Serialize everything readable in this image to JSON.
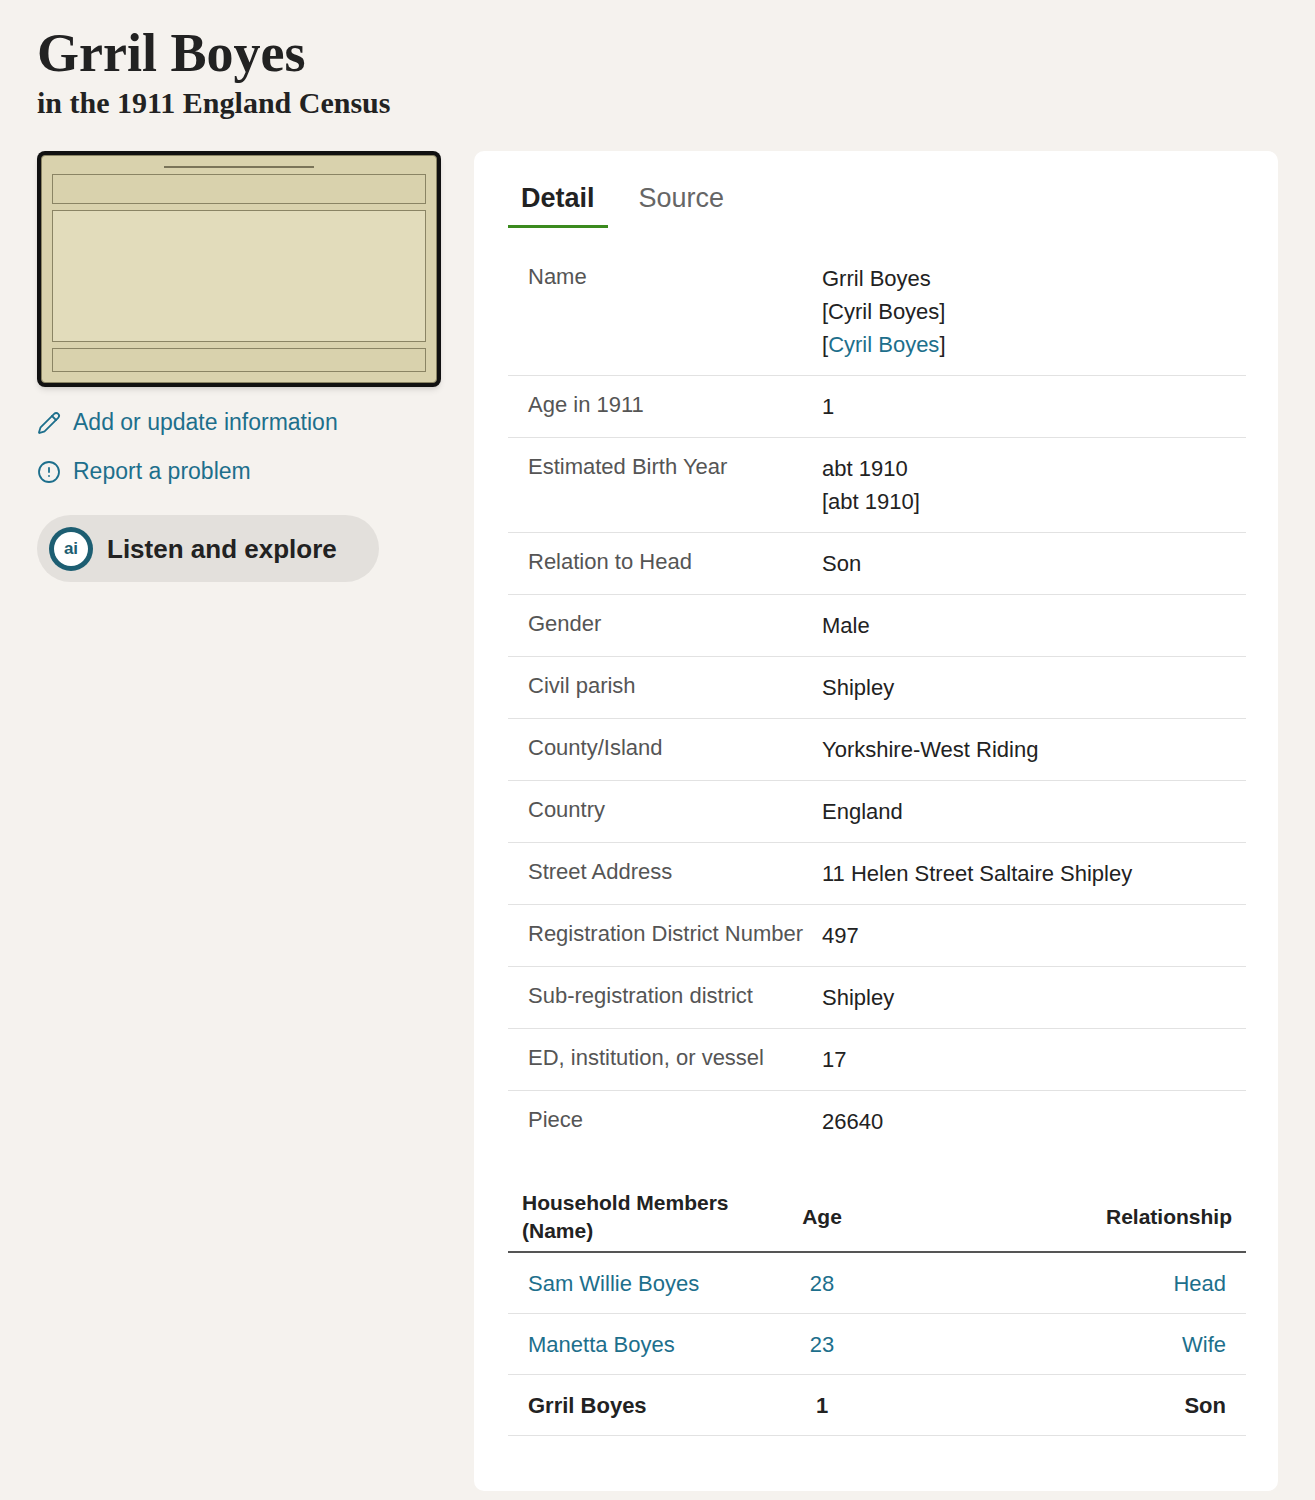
{
  "page": {
    "title": "Grril Boyes",
    "subtitle": "in the 1911 England Census"
  },
  "sidebar": {
    "links": [
      {
        "label": "Add or update information",
        "kind": "edit"
      },
      {
        "label": "Report a problem",
        "kind": "report"
      }
    ],
    "button": {
      "badge": "ai",
      "label": "Listen and explore"
    }
  },
  "tabs": [
    {
      "label": "Detail",
      "selected": true
    },
    {
      "label": "Source",
      "selected": false
    }
  ],
  "details": [
    {
      "label": "Name",
      "values": [
        {
          "prefix": "",
          "text": "Grril Boyes",
          "suffix": "",
          "link": false
        },
        {
          "prefix": "",
          "text": "[Cyril Boyes]",
          "suffix": "",
          "link": false
        },
        {
          "prefix": "[",
          "text": "Cyril Boyes",
          "suffix": "]",
          "link": true
        }
      ]
    },
    {
      "label": "Age in 1911",
      "values": [
        {
          "prefix": "",
          "text": "1",
          "suffix": "",
          "link": false
        }
      ]
    },
    {
      "label": "Estimated Birth Year",
      "values": [
        {
          "prefix": "",
          "text": "abt 1910",
          "suffix": "",
          "link": false
        },
        {
          "prefix": "",
          "text": "[abt 1910]",
          "suffix": "",
          "link": false
        }
      ]
    },
    {
      "label": "Relation to Head",
      "values": [
        {
          "prefix": "",
          "text": "Son",
          "suffix": "",
          "link": false
        }
      ]
    },
    {
      "label": "Gender",
      "values": [
        {
          "prefix": "",
          "text": "Male",
          "suffix": "",
          "link": false
        }
      ]
    },
    {
      "label": "Civil parish",
      "values": [
        {
          "prefix": "",
          "text": "Shipley",
          "suffix": "",
          "link": false
        }
      ]
    },
    {
      "label": "County/Island",
      "values": [
        {
          "prefix": "",
          "text": "Yorkshire-West Riding",
          "suffix": "",
          "link": false
        }
      ]
    },
    {
      "label": "Country",
      "values": [
        {
          "prefix": "",
          "text": "England",
          "suffix": "",
          "link": false
        }
      ]
    },
    {
      "label": "Street Address",
      "values": [
        {
          "prefix": "",
          "text": "11 Helen Street Saltaire Shipley",
          "suffix": "",
          "link": false
        }
      ]
    },
    {
      "label": "Registration District Number",
      "values": [
        {
          "prefix": "",
          "text": "497",
          "suffix": "",
          "link": false
        }
      ]
    },
    {
      "label": "Sub-registration district",
      "values": [
        {
          "prefix": "",
          "text": "Shipley",
          "suffix": "",
          "link": false
        }
      ]
    },
    {
      "label": "ED, institution, or vessel",
      "values": [
        {
          "prefix": "",
          "text": "17",
          "suffix": "",
          "link": false
        }
      ]
    },
    {
      "label": "Piece",
      "values": [
        {
          "prefix": "",
          "text": "26640",
          "suffix": "",
          "link": false
        }
      ]
    }
  ],
  "household": {
    "columns": [
      "Household Members (Name)",
      "Age",
      "Relationship"
    ],
    "rows": [
      {
        "name": "Sam Willie Boyes",
        "age": "28",
        "relationship": "Head",
        "current": false
      },
      {
        "name": "Manetta Boyes",
        "age": "23",
        "relationship": "Wife",
        "current": false
      },
      {
        "name": "Grril Boyes",
        "age": "1",
        "relationship": "Son",
        "current": true
      }
    ]
  }
}
